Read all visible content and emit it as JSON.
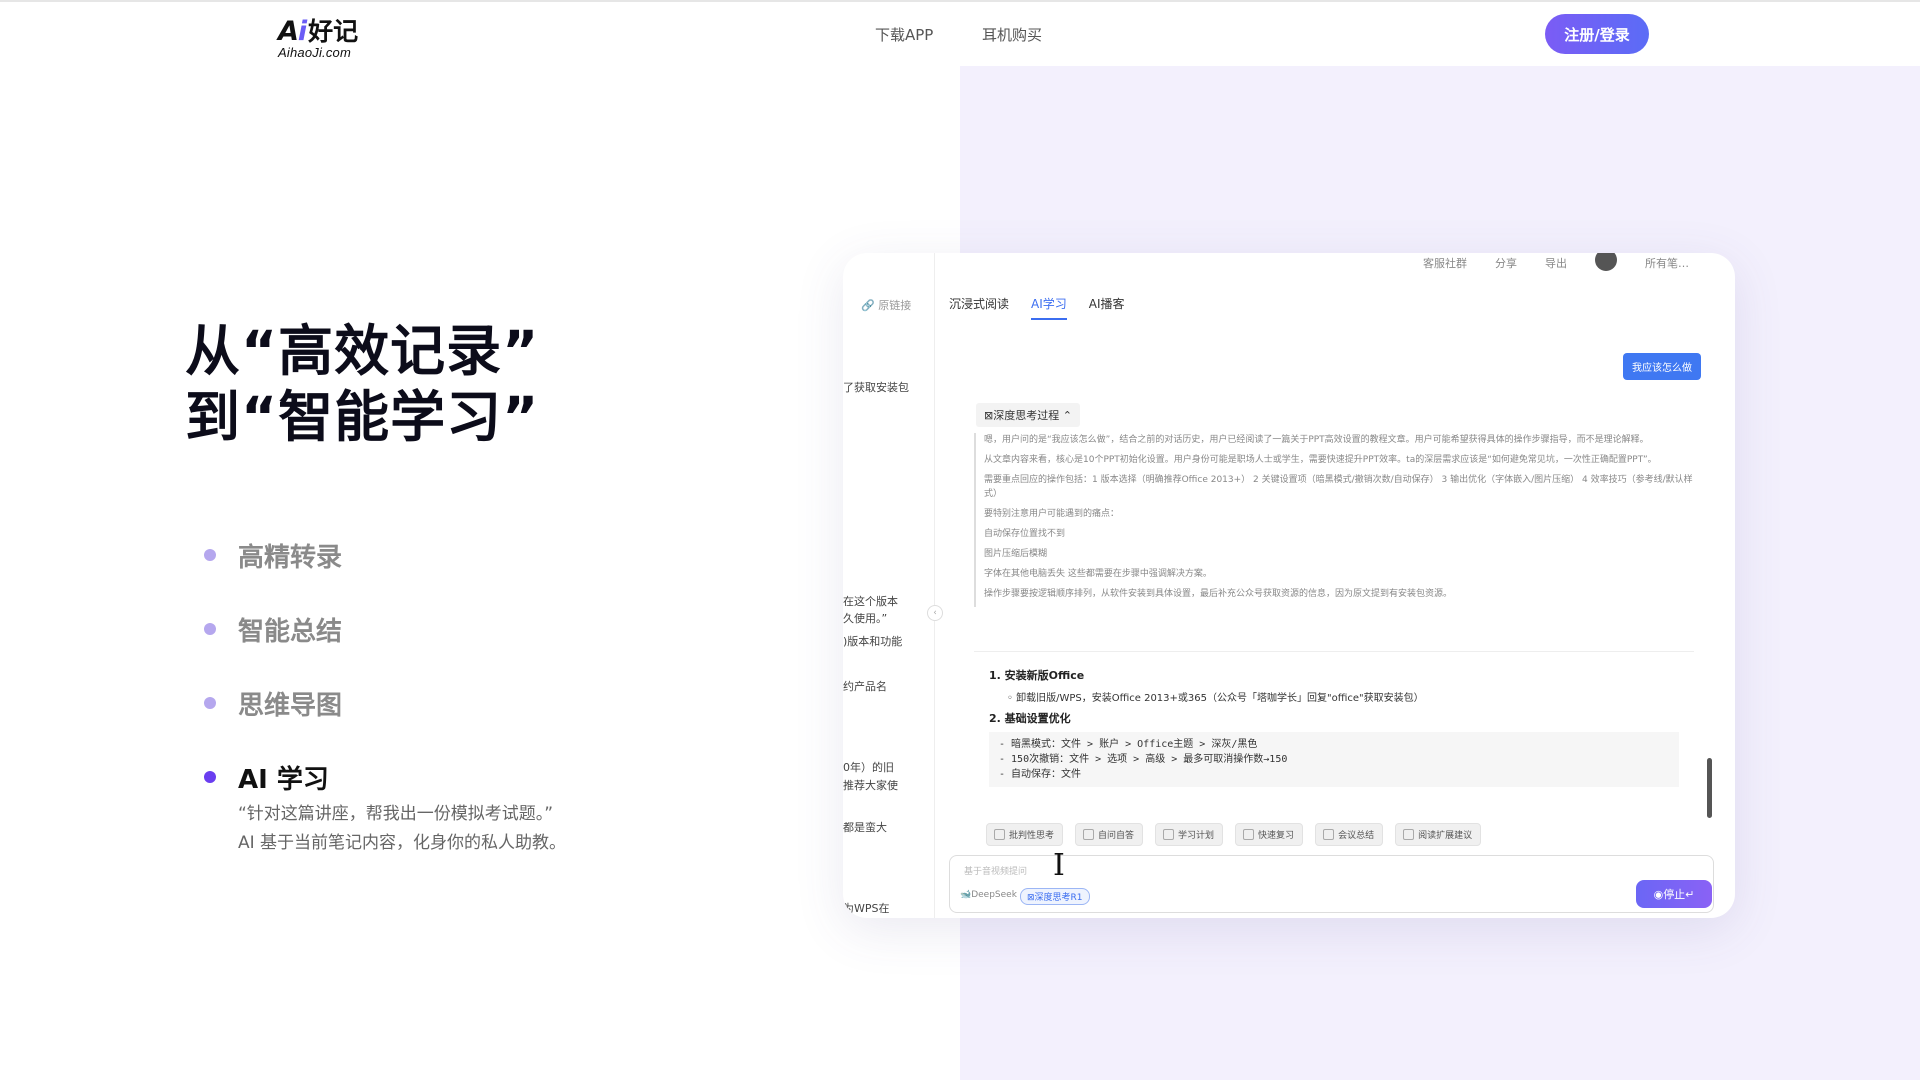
{
  "header": {
    "logo_ai": "Ai",
    "logo_zh": "好记",
    "logo_domain": "AihaoJi.com",
    "nav": [
      "下载APP",
      "耳机购买"
    ],
    "login_label": "注册/登录"
  },
  "hero": {
    "title_line1": "从“高效记录”",
    "title_line2": "到“智能学习”",
    "features": [
      {
        "label": "高精转录",
        "active": false
      },
      {
        "label": "智能总结",
        "active": false
      },
      {
        "label": "思维导图",
        "active": false
      },
      {
        "label": "AI 学习",
        "active": true
      }
    ],
    "desc_line1": "“针对这篇讲座，帮我出一份模拟考试题。”",
    "desc_line2": "AI 基于当前笔记内容，化身你的私人助教。"
  },
  "app": {
    "top_actions": [
      "客服社群",
      "分享",
      "导出",
      "所有笔…"
    ],
    "source_link": "原链接",
    "left_fragments": [
      "了获取安装包",
      "在这个版本",
      "久使用。”",
      ")版本和功能",
      "约产品名",
      "0年）的旧",
      "推荐大家使",
      "都是蛮大",
      "为WPS在"
    ],
    "tabs": [
      {
        "label": "沉浸式阅读",
        "active": false
      },
      {
        "label": "AI学习",
        "active": true
      },
      {
        "label": "AI播客",
        "active": false
      }
    ],
    "user_question": "我应该怎么做",
    "thinking_label": "深度思考过程",
    "thinking_lines": [
      "嗯，用户问的是“我应该怎么做”，结合之前的对话历史，用户已经阅读了一篇关于PPT高效设置的教程文章。用户可能希望获得具体的操作步骤指导，而不是理论解释。",
      "从文章内容来看，核心是10个PPT初始化设置。用户身份可能是职场人士或学生，需要快速提升PPT效率。ta的深层需求应该是“如何避免常见坑，一次性正确配置PPT”。",
      "需要重点回应的操作包括：1 版本选择（明确推荐Office 2013+） 2 关键设置项（暗黑模式/撤销次数/自动保存） 3 输出优化（字体嵌入/图片压缩） 4 效率技巧（参考线/默认样式）",
      "要特别注意用户可能遇到的痛点：",
      "自动保存位置找不到",
      "图片压缩后模糊",
      "字体在其他电脑丢失 这些都需要在步骤中强调解决方案。",
      "操作步骤要按逻辑顺序排列，从软件安装到具体设置，最后补充公众号获取资源的信息，因为原文提到有安装包资源。"
    ],
    "answer": {
      "step1": "1. 安装新版Office",
      "step1_bullet": "卸载旧版/WPS，安装Office 2013+或365（公众号「塔咖学长」回复\"office\"获取安装包）",
      "step2": "2. 基础设置优化",
      "code_lines": [
        "- 暗黑模式：文件 > 账户 > Office主题 > 深灰/黑色",
        "- 150次撤销：文件 > 选项 > 高级 > 最多可取消操作数→150",
        "- 自动保存：文件"
      ]
    },
    "quick_actions": [
      "批判性思考",
      "自问自答",
      "学习计划",
      "快速复习",
      "会议总结",
      "阅读扩展建议"
    ],
    "input_placeholder": "基于音视频提问",
    "model_label": "DeepSeek",
    "deep_toggle": "深度思考R1",
    "stop_label": "停止↵"
  }
}
